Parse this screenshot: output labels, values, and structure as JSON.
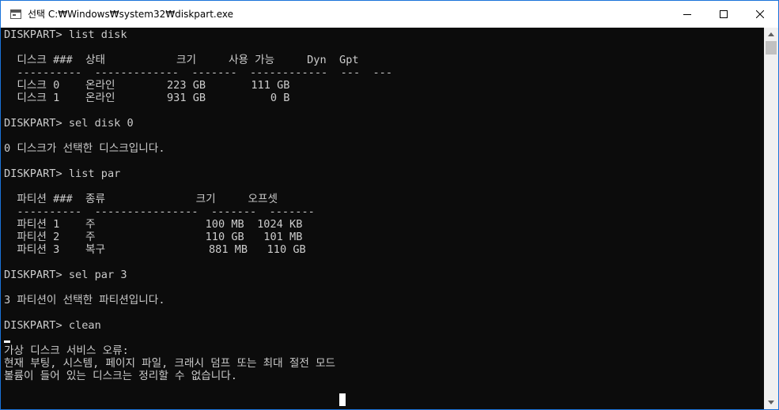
{
  "window": {
    "title": "선택 C:₩Windows₩system32₩diskpart.exe",
    "icon": "console-app-icon",
    "controls": [
      "minimize-icon",
      "maximize-icon",
      "close-icon"
    ]
  },
  "console": {
    "lines": [
      "DISKPART> list disk",
      "",
      "  디스크 ###  상태           크기     사용 가능     Dyn  Gpt",
      "  ----------  -------------  -------  ------------  ---  ---",
      "  디스크 0    온라인        223 GB       111 GB",
      "  디스크 1    온라인        931 GB          0 B",
      "",
      "DISKPART> sel disk 0",
      "",
      "0 디스크가 선택한 디스크입니다.",
      "",
      "DISKPART> list par",
      "",
      "  파티션 ###  종류              크기     오프셋",
      "  ----------  ----------------  -------  -------",
      "  파티션 1    주                 100 MB  1024 KB",
      "  파티션 2    주                 110 GB   101 MB",
      "  파티션 3    복구                881 MB   110 GB",
      "",
      "DISKPART> sel par 3",
      "",
      "3 파티션이 선택한 파티션입니다.",
      "",
      "DISKPART> clean",
      "",
      "가상 디스크 서비스 오류:",
      "현재 부팅, 시스템, 페이지 파일, 크래시 덤프 또는 최대 절전 모드",
      "볼륨이 들어 있는 디스크는 정리할 수 없습니다."
    ]
  },
  "colors": {
    "console_bg": "#0c0c0c",
    "console_text": "#cccccc",
    "window_border": "#1a73d9",
    "titlebar_bg": "#ffffff"
  }
}
